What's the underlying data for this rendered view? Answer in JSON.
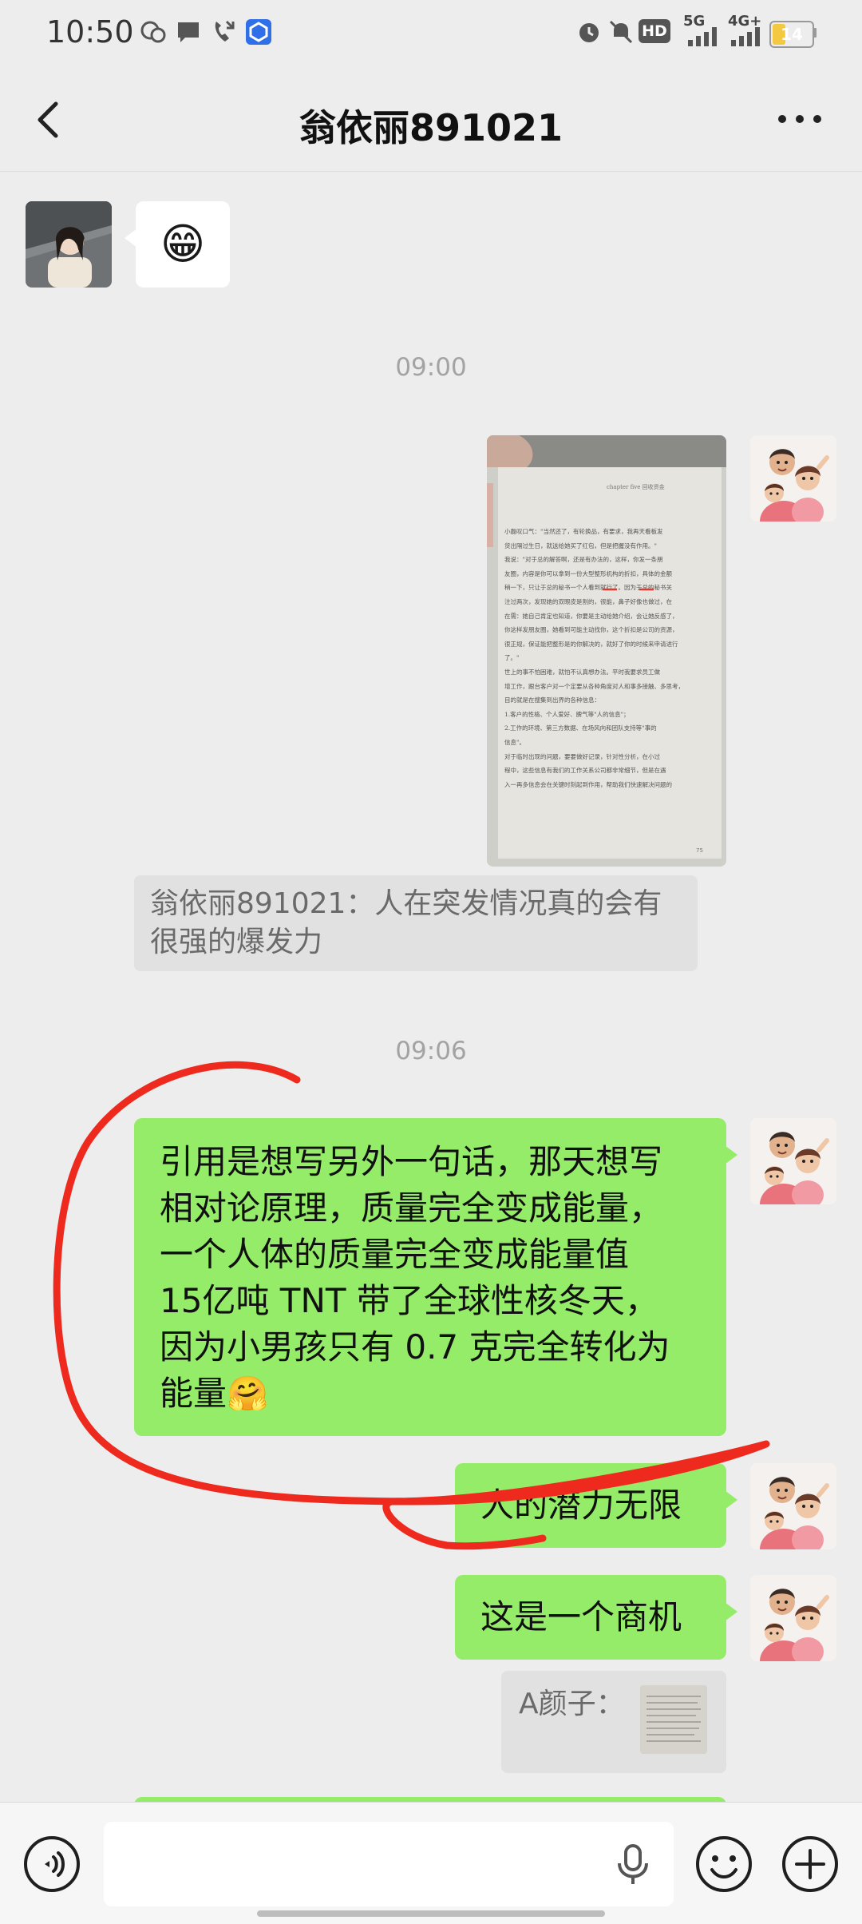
{
  "status": {
    "time": "10:50",
    "hd_label": "HD",
    "network_5g": "5G",
    "network_4g": "4G+",
    "battery": "14"
  },
  "header": {
    "title": "翁依丽891021"
  },
  "messages": {
    "m1_emoji": "😁",
    "ts1": "09:00",
    "quote1": "翁依丽891021：人在突发情况真的会有很强的爆发力",
    "ts2": "09:06",
    "m3_lines": [
      "引用是想写另外一句话，那天想写",
      "相对论原理，质量完全变成能量，",
      "一个人体的质量完全变成能量值",
      "15亿吨 TNT 带了全球性核冬天，",
      "因为小男孩只有 0.7 克完全转化为",
      "能量🤗"
    ],
    "m4": "人的潜力无限",
    "m5": "这是一个商机",
    "quote2": "A颜子："
  },
  "book_page": {
    "header": "chapter five 回收资金",
    "lines": [
      "小磊叹口气：\"当然还了，有轮换品，有要求，我再天看板发",
      "货出隔过生日，就送给她买了红包，但是把握没有作用。\"",
      "我说：\"对于总的解答啊，还是有办法的，这样，你发一条朋",
      "友圈，内容是你可以拿到一份大型整形机构的折扣，具体的金额",
      "稍一下，只让于总的秘书一个人看到就行了。因为于总的秘书关",
      "注过两次，发现她的双眼皮是割的，很能，鼻子好像也做过，在",
      "在需：她自己肯定也知道，你要是主动给她介绍，会让她反感了，",
      "你这样发朋友圈，她看到可能主动找你，这个折扣是公司的资源，",
      "很正规，保证能把整形是的你解决的，就好了你的时候来申请进行",
      "了。\"",
      "世上的事不怕困难，就怕不认真想办法。平时我要求员工做",
      "增工作，跟台客户对一个定要从各种角度对人和事多接触、多思考，",
      "目的就是在搜集到出界的各种信息：",
      "1.客户的性格、个人爱好、脾气等\"人的信息\"；",
      "2.工作的环境、第三方数据、在场风向和团队支持等\"事的",
      "信息\"。",
      "对于临时出现的问题，要要做好记录，针对性分析，在小过",
      "程中，这些信息有我们的工作关系公司都非常细节，但是在遇",
      "入一再多信息会在关键时刻起到作用，帮助我们快速解决问题的"
    ],
    "page_number": "75"
  },
  "input": {
    "placeholder": ""
  },
  "icons": {
    "back": "chevron-left-icon",
    "more": "more-dots-icon",
    "voice": "voice-icon",
    "mic": "mic-icon",
    "emoji": "emoji-icon",
    "plus": "plus-icon"
  },
  "colors": {
    "background": "#ededed",
    "sent_bubble": "#95ec69",
    "received_bubble": "#ffffff",
    "annotation": "#ee2a1e",
    "battery": "#f5c842"
  }
}
